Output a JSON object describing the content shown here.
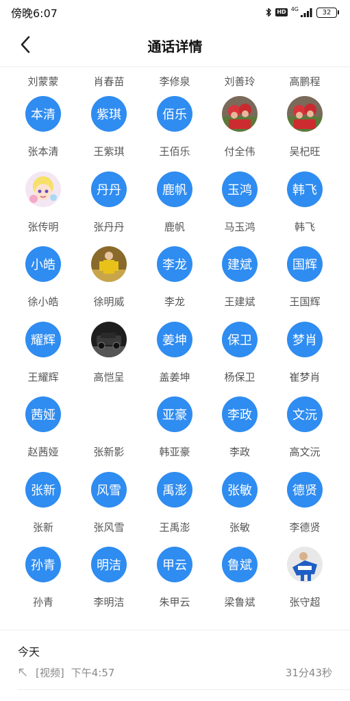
{
  "status_bar": {
    "time": "傍晚6:07",
    "bluetooth_icon": "bluetooth-icon",
    "hd_label": "HD",
    "network_label": "4G",
    "battery_level": "32"
  },
  "header": {
    "back_icon": "chevron-left-icon",
    "title": "通话详情"
  },
  "participants": {
    "top_partial_row": [
      "刘蒙蒙",
      "肖春苗",
      "李修泉",
      "刘善玲",
      "高鹏程"
    ],
    "rows": [
      [
        {
          "avatar_text": "本清",
          "name": "张本清",
          "avatar_type": "text"
        },
        {
          "avatar_text": "紫琪",
          "name": "王紫琪",
          "avatar_type": "text"
        },
        {
          "avatar_text": "佰乐",
          "name": "王佰乐",
          "avatar_type": "text"
        },
        {
          "avatar_text": "",
          "name": "付全伟",
          "avatar_type": "photo",
          "photo_icon": "group-photo-icon"
        },
        {
          "avatar_text": "",
          "name": "吴杞旺",
          "avatar_type": "photo",
          "photo_icon": "group-photo-icon"
        }
      ],
      [
        {
          "avatar_text": "",
          "name": "张传明",
          "avatar_type": "photo",
          "photo_icon": "cartoon-photo-icon"
        },
        {
          "avatar_text": "丹丹",
          "name": "张丹丹",
          "avatar_type": "text"
        },
        {
          "avatar_text": "鹿帆",
          "name": "鹿帆",
          "avatar_type": "text"
        },
        {
          "avatar_text": "玉鸿",
          "name": "马玉鸿",
          "avatar_type": "text"
        },
        {
          "avatar_text": "韩飞",
          "name": "韩飞",
          "avatar_type": "text"
        }
      ],
      [
        {
          "avatar_text": "小皓",
          "name": "徐小皓",
          "avatar_type": "text"
        },
        {
          "avatar_text": "",
          "name": "徐明威",
          "avatar_type": "photo",
          "photo_icon": "person-photo-icon"
        },
        {
          "avatar_text": "李龙",
          "name": "李龙",
          "avatar_type": "text"
        },
        {
          "avatar_text": "建斌",
          "name": "王建斌",
          "avatar_type": "text"
        },
        {
          "avatar_text": "国辉",
          "name": "王国辉",
          "avatar_type": "text"
        }
      ],
      [
        {
          "avatar_text": "耀辉",
          "name": "王耀辉",
          "avatar_type": "text"
        },
        {
          "avatar_text": "",
          "name": "高恺呈",
          "avatar_type": "photo",
          "photo_icon": "car-photo-icon"
        },
        {
          "avatar_text": "姜坤",
          "name": "盖姜坤",
          "avatar_type": "text"
        },
        {
          "avatar_text": "保卫",
          "name": "杨保卫",
          "avatar_type": "text"
        },
        {
          "avatar_text": "梦肖",
          "name": "崔梦肖",
          "avatar_type": "text"
        }
      ],
      [
        {
          "avatar_text": "茜娅",
          "name": "赵茜娅",
          "avatar_type": "text"
        },
        {
          "avatar_text": "",
          "name": "张新影",
          "avatar_type": "empty"
        },
        {
          "avatar_text": "亚豪",
          "name": "韩亚豪",
          "avatar_type": "text"
        },
        {
          "avatar_text": "李政",
          "name": "李政",
          "avatar_type": "text"
        },
        {
          "avatar_text": "文沅",
          "name": "高文沅",
          "avatar_type": "text"
        }
      ],
      [
        {
          "avatar_text": "张新",
          "name": "张新",
          "avatar_type": "text"
        },
        {
          "avatar_text": "风雪",
          "name": "张风雪",
          "avatar_type": "text"
        },
        {
          "avatar_text": "禹澎",
          "name": "王禹澎",
          "avatar_type": "text"
        },
        {
          "avatar_text": "张敏",
          "name": "张敏",
          "avatar_type": "text"
        },
        {
          "avatar_text": "德贤",
          "name": "李德贤",
          "avatar_type": "text"
        }
      ],
      [
        {
          "avatar_text": "孙青",
          "name": "孙青",
          "avatar_type": "text"
        },
        {
          "avatar_text": "明洁",
          "name": "李明洁",
          "avatar_type": "text"
        },
        {
          "avatar_text": "甲云",
          "name": "朱甲云",
          "avatar_type": "text"
        },
        {
          "avatar_text": "鲁斌",
          "name": "梁鲁斌",
          "avatar_type": "text"
        },
        {
          "avatar_text": "",
          "name": "张守超",
          "avatar_type": "photo",
          "photo_icon": "sport-photo-icon"
        }
      ]
    ]
  },
  "record": {
    "date_label": "今天",
    "direction_icon": "outgoing-arrow-icon",
    "type_label": "[视频]",
    "time_label": "下午4:57",
    "duration_label": "31分43秒"
  },
  "colors": {
    "avatar_blue": "#2f8cf0",
    "text_gray": "#555555",
    "record_gray": "#888888"
  }
}
